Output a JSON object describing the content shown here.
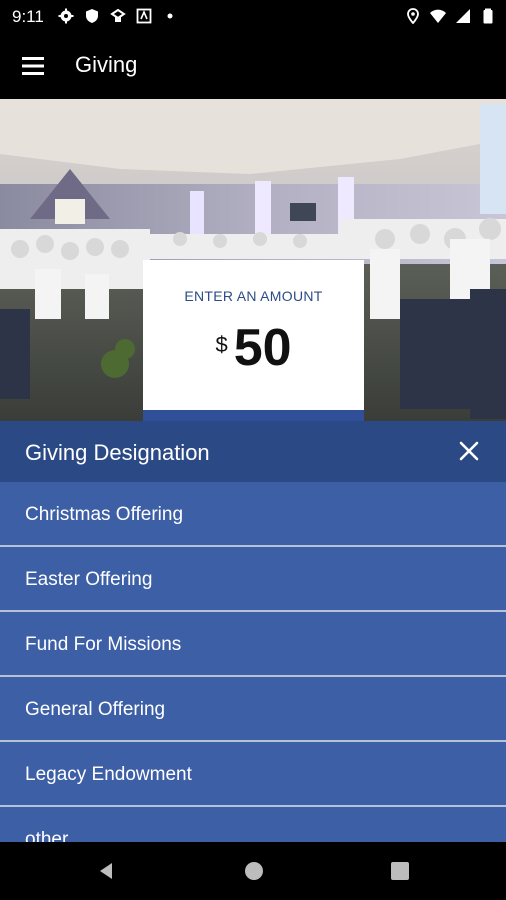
{
  "status_bar": {
    "time": "9:11",
    "left_icons": [
      "settings-icon",
      "shield-icon",
      "sync-icon",
      "app-icon",
      "dot-icon"
    ],
    "right_icons": [
      "location-icon",
      "wifi-icon",
      "signal-icon",
      "battery-icon"
    ]
  },
  "app_bar": {
    "title": "Giving",
    "menu_icon": "menu-icon"
  },
  "amount": {
    "label": "ENTER AN AMOUNT",
    "currency": "$",
    "value": "50"
  },
  "designation": {
    "title": "Giving Designation",
    "close_icon": "close-icon",
    "items": [
      {
        "label": "Christmas Offering"
      },
      {
        "label": "Easter Offering"
      },
      {
        "label": "Fund For Missions"
      },
      {
        "label": "General Offering"
      },
      {
        "label": "Legacy Endowment"
      },
      {
        "label": "other"
      }
    ]
  },
  "nav_bar": {
    "icons": [
      "back-icon",
      "home-icon",
      "recents-icon"
    ]
  },
  "colors": {
    "accent": "#2f5099",
    "sheet_header": "#2b4a85",
    "sheet_body": "#3d5fa6",
    "amount_label": "#2c4c88"
  }
}
